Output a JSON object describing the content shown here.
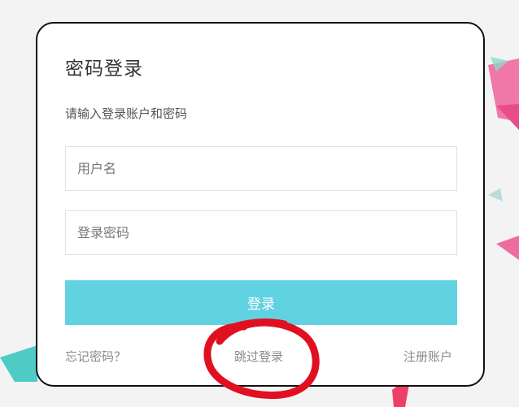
{
  "login": {
    "title": "密码登录",
    "subtitle": "请输入登录账户和密码",
    "username_placeholder": "用户名",
    "password_placeholder": "登录密码",
    "submit_label": "登录",
    "forgot_label": "忘记密码？",
    "skip_label": "跳过登录",
    "register_label": "注册账户"
  },
  "colors": {
    "accent": "#61d2e1",
    "annotation": "#e01020"
  }
}
